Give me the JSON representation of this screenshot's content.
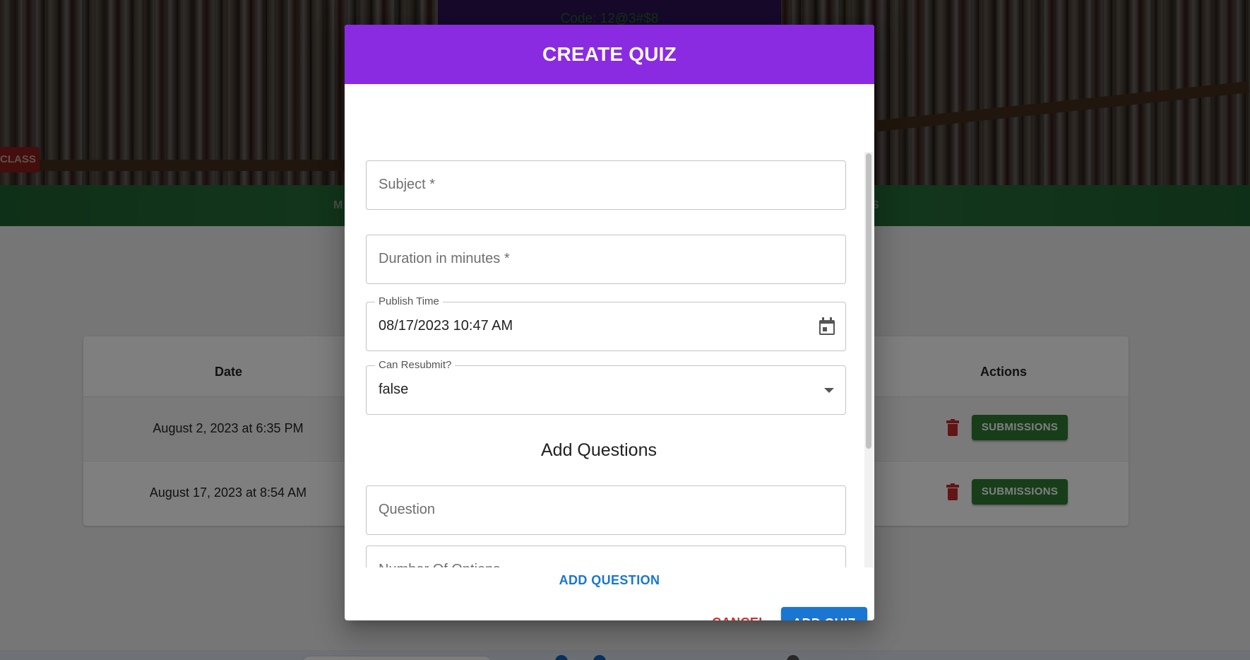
{
  "background_page": {
    "class_code": "Code: 12@3#$8",
    "class_button_label": "CLASS",
    "nav_tab_left": "M",
    "nav_tab_right": "S",
    "table": {
      "columns": [
        "Date",
        "Actions"
      ],
      "rows": [
        {
          "date": "August 2, 2023 at 6:35 PM",
          "action_label": "SUBMISSIONS"
        },
        {
          "date": "August 17, 2023 at 8:54 AM",
          "action_label": "SUBMISSIONS"
        }
      ]
    }
  },
  "dialog": {
    "title": "CREATE QUIZ",
    "fields": {
      "subject_placeholder": "Subject *",
      "duration_placeholder": "Duration in minutes *",
      "publish_time_label": "Publish Time",
      "publish_time_value": "08/17/2023 10:47 AM",
      "can_resubmit_label": "Can Resubmit?",
      "can_resubmit_value": "false",
      "question_placeholder": "Question",
      "number_of_options_placeholder": "Number Of Options"
    },
    "section_title": "Add Questions",
    "add_question_label": "ADD QUESTION",
    "cancel_label": "CANCEL",
    "add_quiz_label": "ADD QUIZ"
  },
  "colors": {
    "dialog_header": "#8a2be2",
    "primary": "#1976d2",
    "cancel": "#d32f2f",
    "submissions_button": "#2e7d32",
    "delete_icon": "#c62828",
    "nav_bar": "#3aa857"
  }
}
